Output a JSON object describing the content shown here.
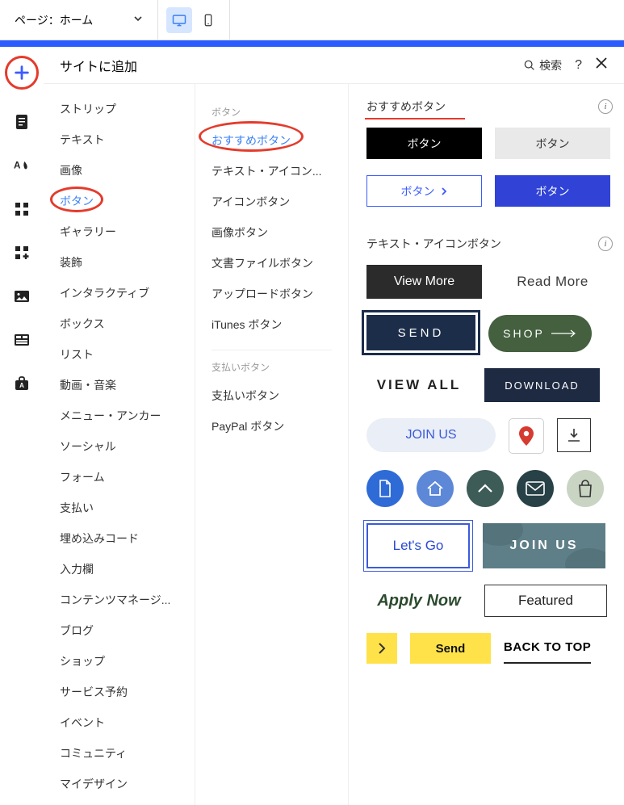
{
  "topbar": {
    "page_label": "ページ：ホーム"
  },
  "panel": {
    "title": "サイトに追加",
    "search_label": "検索"
  },
  "categories": [
    "ストリップ",
    "テキスト",
    "画像",
    "ボタン",
    "ギャラリー",
    "装飾",
    "インタラクティブ",
    "ボックス",
    "リスト",
    "動画・音楽",
    "メニュー・アンカー",
    "ソーシャル",
    "フォーム",
    "支払い",
    "埋め込みコード",
    "入力欄",
    "コンテンツマネージ...",
    "ブログ",
    "ショップ",
    "サービス予約",
    "イベント",
    "コミュニティ",
    "マイデザイン"
  ],
  "selected_category_index": 3,
  "sub_groups": [
    {
      "title": "ボタン",
      "items": [
        "おすすめボタン",
        "テキスト・アイコン...",
        "アイコンボタン",
        "画像ボタン",
        "文書ファイルボタン",
        "アップロードボタン",
        "iTunes ボタン"
      ],
      "selected_index": 0
    },
    {
      "title": "支払いボタン",
      "items": [
        "支払いボタン",
        "PayPal ボタン"
      ]
    }
  ],
  "sections": [
    {
      "title": "おすすめボタン"
    },
    {
      "title": "テキスト・アイコンボタン"
    }
  ],
  "demos": {
    "btn_jp": "ボタン",
    "view_more": "View More",
    "read_more": "Read More",
    "send": "SEND",
    "shop": "SHOP",
    "view_all": "VIEW ALL",
    "download": "DOWNLOAD",
    "join_us": "JOIN US",
    "lets_go": "Let's Go",
    "join_us2": "JOIN US",
    "apply_now": "Apply Now",
    "featured": "Featured",
    "send2": "Send",
    "back_top": "BACK TO TOP"
  }
}
